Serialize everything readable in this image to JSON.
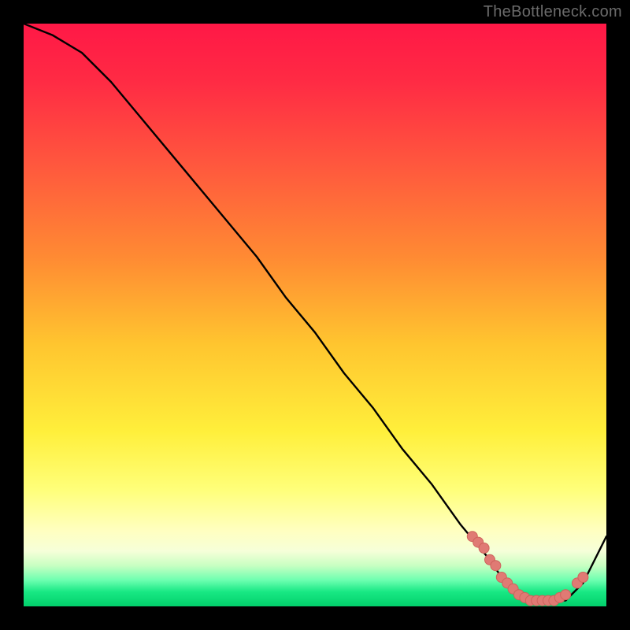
{
  "watermark": "TheBottleneck.com",
  "colors": {
    "bg_black": "#000000",
    "watermark_gray": "#6b6b6b",
    "gradient_top": "#ff1846",
    "gradient_mid_red": "#ff4a3f",
    "gradient_orange": "#ff9a2d",
    "gradient_yellow": "#ffe738",
    "gradient_pale_yellow": "#ffff9b",
    "gradient_green": "#05e070",
    "curve_black": "#000000",
    "marker_fill": "#e07a74",
    "marker_stroke": "#ce635c"
  },
  "chart_data": {
    "type": "line",
    "title": "",
    "xlabel": "",
    "ylabel": "",
    "xlim": [
      0,
      100
    ],
    "ylim": [
      0,
      100
    ],
    "series": [
      {
        "name": "bottleneck-curve",
        "x": [
          0,
          5,
          10,
          15,
          20,
          25,
          30,
          35,
          40,
          45,
          50,
          55,
          60,
          65,
          70,
          75,
          80,
          82,
          85,
          88,
          90,
          93,
          96,
          100
        ],
        "y": [
          100,
          98,
          95,
          90,
          84,
          78,
          72,
          66,
          60,
          53,
          47,
          40,
          34,
          27,
          21,
          14,
          8,
          5,
          2,
          1,
          1,
          1,
          4,
          12
        ]
      }
    ],
    "markers": {
      "name": "highlighted-range",
      "x": [
        77,
        78,
        79,
        80,
        81,
        82,
        83,
        84,
        85,
        86,
        87,
        88,
        89,
        90,
        91,
        92,
        93,
        95,
        96
      ],
      "y": [
        12,
        11,
        10,
        8,
        7,
        5,
        4,
        3,
        2,
        1.5,
        1,
        1,
        1,
        1,
        1,
        1.5,
        2,
        4,
        5
      ]
    }
  }
}
